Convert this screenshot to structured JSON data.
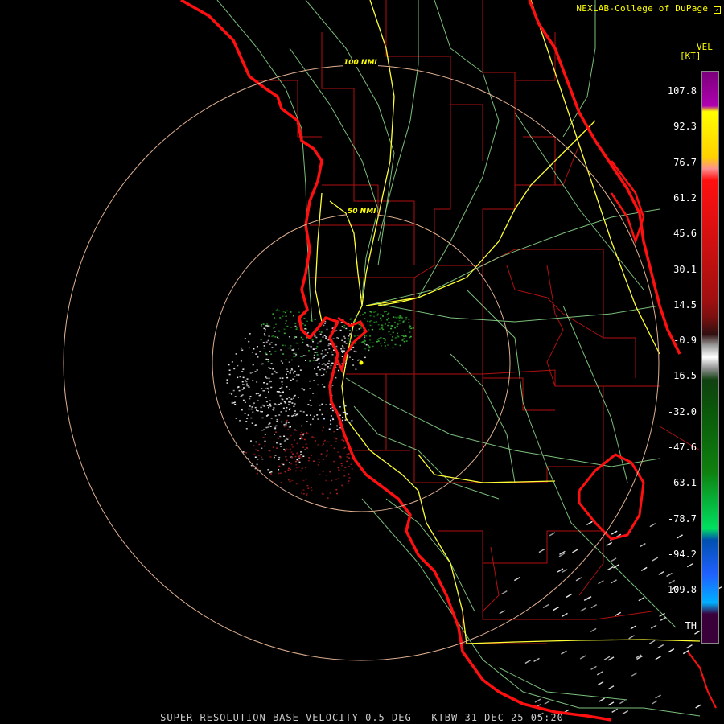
{
  "header": {
    "credit": "NEXLAB-College of DuPage"
  },
  "legend": {
    "title": "VEL",
    "unit": "[KT]",
    "ticks": [
      "107.8",
      "92.3",
      "76.7",
      "61.2",
      "45.6",
      "30.1",
      "14.5",
      "-0.9",
      "-16.5",
      "-32.0",
      "-47.6",
      "-63.1",
      "-78.7",
      "-94.2",
      "-109.8",
      "TH"
    ]
  },
  "range_rings": [
    "100 NMI",
    "50 NMI"
  ],
  "footer": {
    "caption": "SUPER-RESOLUTION BASE VELOCITY 0.5 DEG - KTBW 31 DEC 25 05:20"
  },
  "colors": {
    "coastline": "#ff1010",
    "county": "#b01010",
    "highway": "#ffff33",
    "road": "#90e090",
    "ring": "#e0b090",
    "inbound_green": "#1a8a1a",
    "outbound_red": "#a01818",
    "near_zero_gray": "#c8c8c8",
    "scale_top": "#7a007a",
    "scale_th": "#3a003a"
  }
}
